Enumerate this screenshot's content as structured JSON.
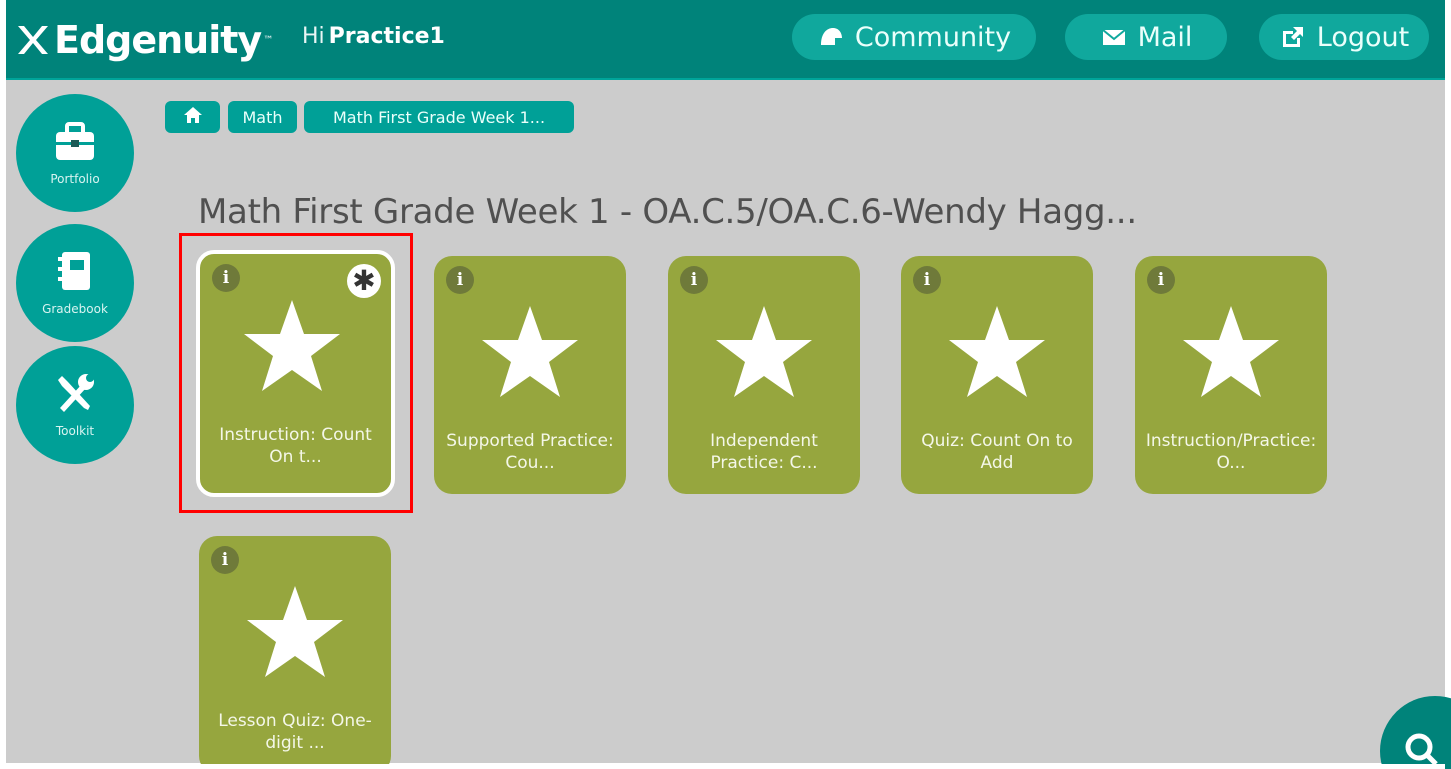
{
  "header": {
    "brand": "Edgenuity",
    "brand_tm": "™",
    "greeting_prefix": "Hi",
    "username": "Practice1",
    "nav": [
      {
        "label": "Community",
        "icon": "helmet-icon"
      },
      {
        "label": "Mail",
        "icon": "envelope-icon"
      },
      {
        "label": "Logout",
        "icon": "logout-icon"
      }
    ]
  },
  "sidebar": {
    "items": [
      {
        "label": "Portfolio",
        "icon": "briefcase-icon"
      },
      {
        "label": "Gradebook",
        "icon": "notebook-icon"
      },
      {
        "label": "Toolkit",
        "icon": "tools-icon"
      }
    ]
  },
  "breadcrumb": {
    "home_icon": "home-icon",
    "items": [
      "Math",
      "Math First Grade Week 1..."
    ]
  },
  "page": {
    "title": "Math First Grade Week 1 - OA.C.5/OA.C.6-Wendy Hagg..."
  },
  "tiles": [
    {
      "label": "Instruction: Count On t...",
      "info": "i",
      "badge": "✱",
      "selected": true
    },
    {
      "label": "Supported Practice: Cou...",
      "info": "i"
    },
    {
      "label": "Independent Practice: C...",
      "info": "i"
    },
    {
      "label": "Quiz: Count On to Add",
      "info": "i"
    },
    {
      "label": "Instruction/Practice: O...",
      "info": "i"
    },
    {
      "label": "Lesson Quiz: One-digit ...",
      "info": "i"
    }
  ],
  "colors": {
    "header_bg": "#00837a",
    "accent_teal": "#00a097",
    "tile_green": "#96a63e",
    "page_bg": "#cccccc",
    "highlight": "#ff0000"
  }
}
